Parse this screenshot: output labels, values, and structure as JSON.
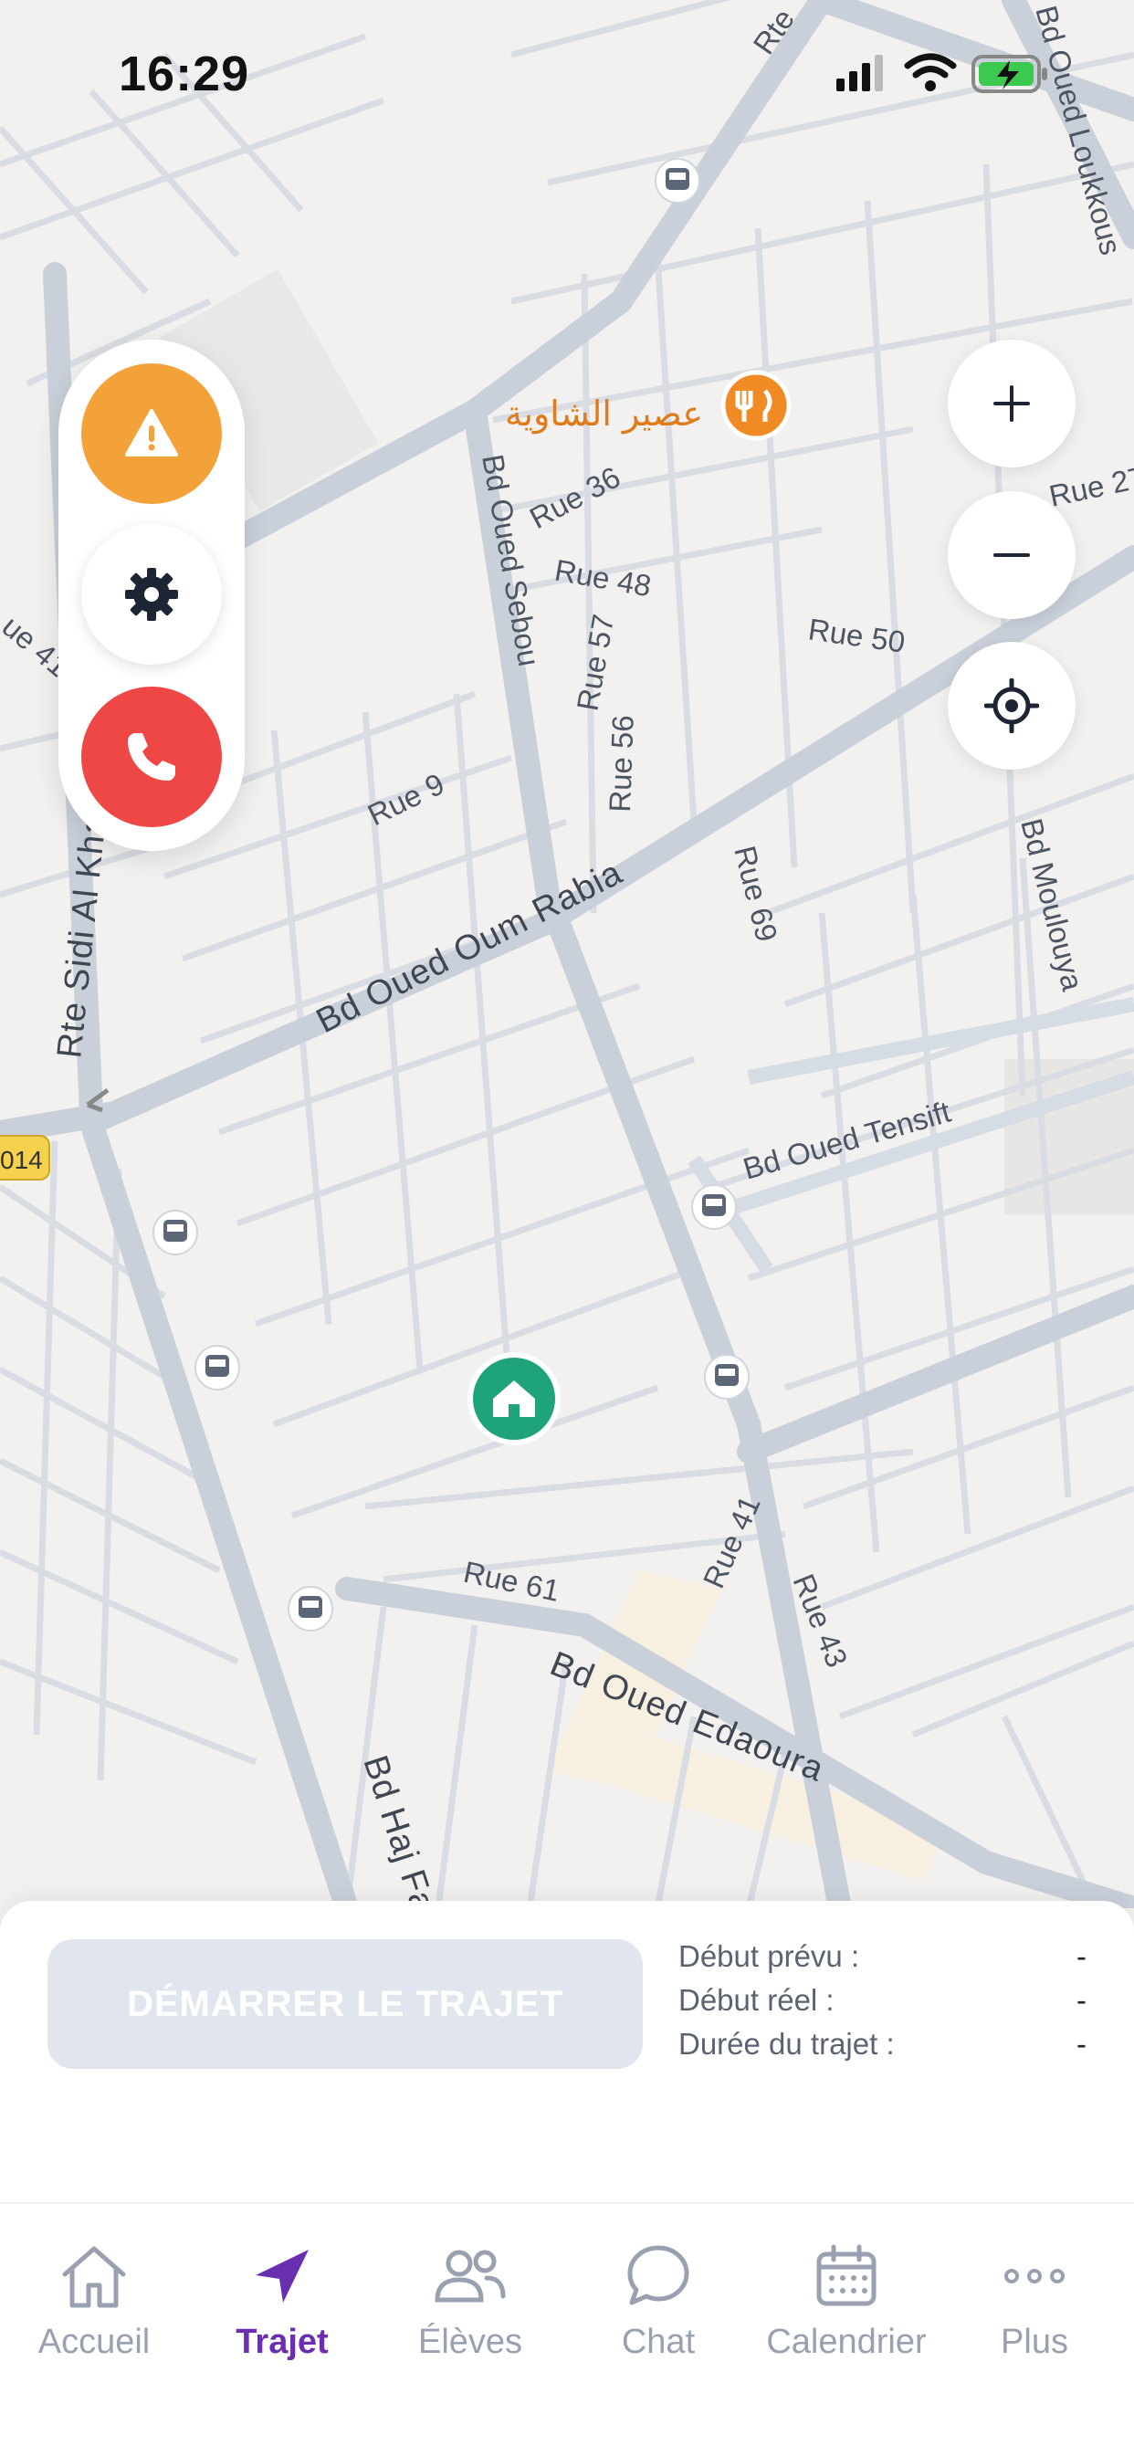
{
  "status_bar": {
    "time": "16:29"
  },
  "map": {
    "labels": {
      "rte_sidi_al_khadir": "Rte Sidi Al Khadir",
      "bd_oued_sebou": "Bd Oued Sebou",
      "bd_oued_oum_rabia": "Bd Oued Oum Rabia",
      "bd_oued_tensift": "Bd Oued Tensift",
      "bd_oued_edaoura": "Bd Oued Edaoura",
      "bd_moulouya": "Bd Moulouya",
      "bd_oued_loukkous": "Bd Oued Loukkous",
      "bd_haj_fa": "Bd Haj Fa",
      "rte": "Rte",
      "rue_9": "Rue 9",
      "rue_36": "Rue 36",
      "rue_48": "Rue 48",
      "rue_50": "Rue 50",
      "rue_57": "Rue 57",
      "rue_56": "Rue 56",
      "rue_69": "Rue 69",
      "rue_41_left": "ue 41",
      "rue_27": "Rue 27",
      "rue_61": "Rue 61",
      "rue_41": "Rue 41",
      "rue_43": "Rue 43",
      "road_badge": "014",
      "poi_restaurant": "عصير الشاوية"
    },
    "icons": {
      "restaurant": "fork-knife-icon",
      "bus": "bus-stop-icon",
      "home": "school-icon"
    }
  },
  "actions": {
    "alert": "warning-icon",
    "settings": "gear-icon",
    "call": "phone-icon"
  },
  "zoom": {
    "in": "+",
    "out": "−",
    "locate": "crosshair-icon"
  },
  "trip": {
    "start_button": "DÉMARRER LE TRAJET",
    "planned_start_label": "Début prévu :",
    "planned_start_value": "-",
    "actual_start_label": "Début réel :",
    "actual_start_value": "-",
    "duration_label": "Durée du trajet :",
    "duration_value": "-"
  },
  "tabs": [
    {
      "label": "Accueil",
      "icon": "home-icon"
    },
    {
      "label": "Trajet",
      "icon": "navigation-arrow-icon"
    },
    {
      "label": "Élèves",
      "icon": "users-icon"
    },
    {
      "label": "Chat",
      "icon": "chat-bubble-icon"
    },
    {
      "label": "Calendrier",
      "icon": "calendar-icon"
    },
    {
      "label": "Plus",
      "icon": "more-dots-icon"
    }
  ],
  "colors": {
    "accent": "#6a2fb0",
    "alert": "#f3a23a",
    "call": "#ef4646",
    "school_pin": "#1fa37a",
    "restaurant_pin": "#f08a24"
  }
}
